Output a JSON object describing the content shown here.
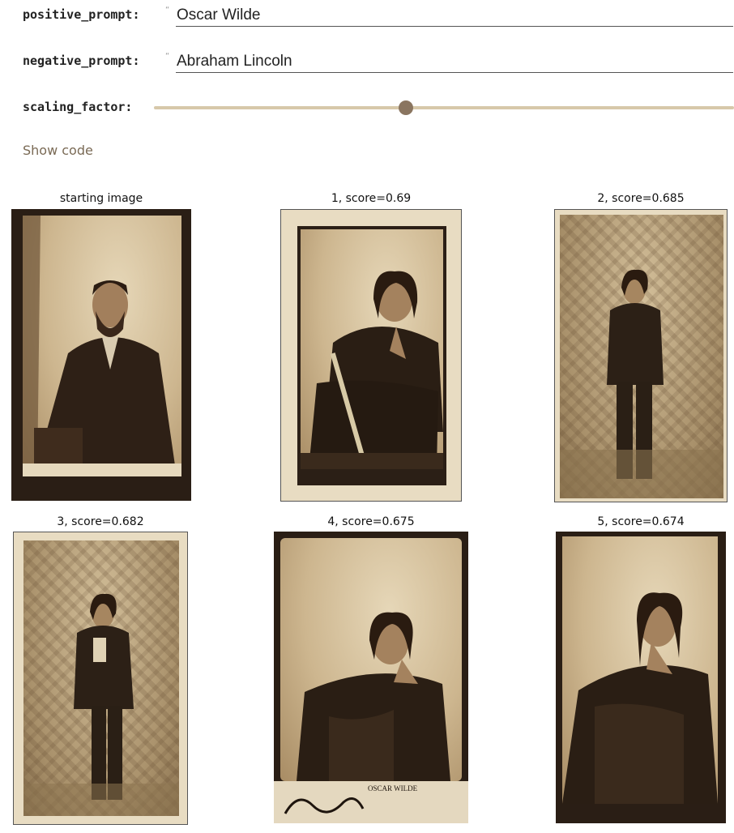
{
  "params": {
    "positive_label": "positive_prompt:",
    "positive_value": "Oscar Wilde",
    "negative_label": "negative_prompt:",
    "negative_value": "Abraham Lincoln",
    "scaling_label": "scaling_factor:",
    "scaling_value": 0.44
  },
  "show_code": "Show code",
  "results": [
    {
      "title": "starting image",
      "subject": "seated portrait, Abraham Lincoln"
    },
    {
      "title": "1, score=0.69",
      "subject": "seated portrait with cane"
    },
    {
      "title": "2, score=0.685",
      "subject": "standing portrait, ornate backdrop"
    },
    {
      "title": "3, score=0.682",
      "subject": "standing portrait, ornate backdrop"
    },
    {
      "title": "4, score=0.675",
      "subject": "seated portrait, hand on chin"
    },
    {
      "title": "5, score=0.674",
      "subject": "seated portrait in fur coat"
    }
  ],
  "card_captions": {
    "card4": "OSCAR WILDE"
  },
  "colors": {
    "accent": "#8a7560",
    "track": "#d7c8aa",
    "link": "#7a6a55"
  }
}
